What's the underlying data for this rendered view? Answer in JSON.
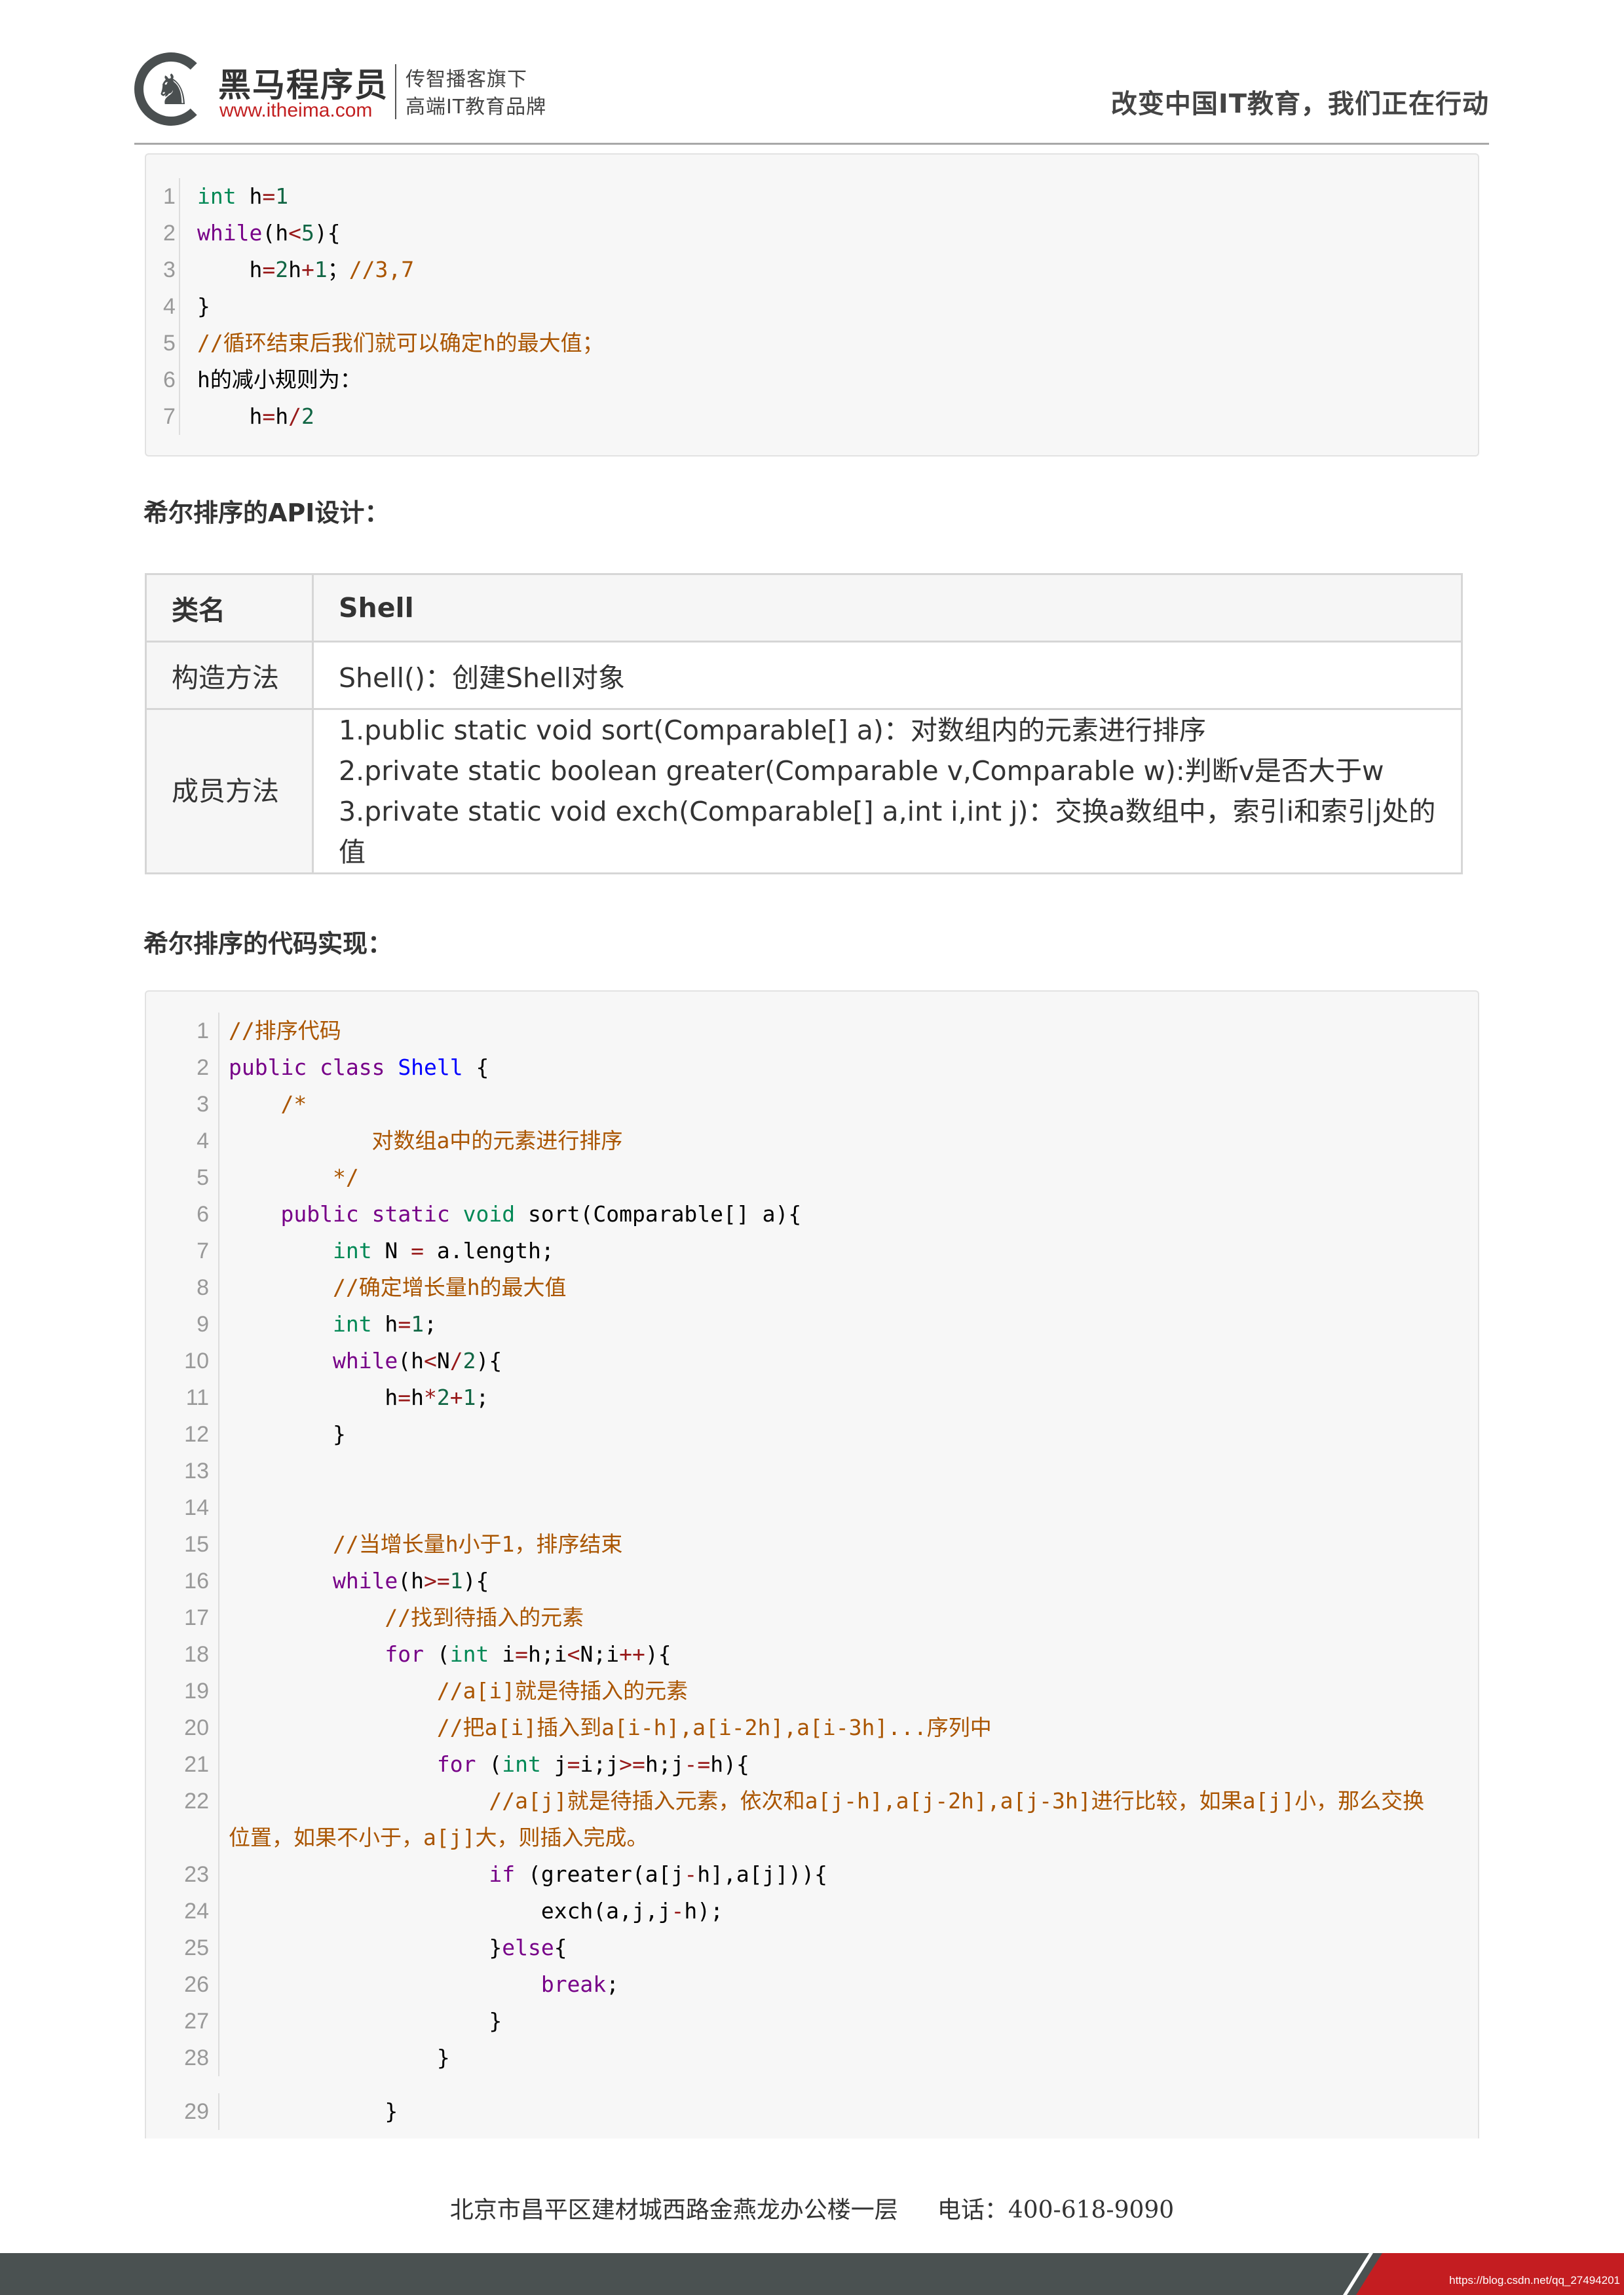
{
  "header": {
    "brand": "黑马程序员",
    "url": "www.itheima.com",
    "tagline1": "传智播客旗下",
    "tagline2": "高端IT教育品牌",
    "slogan": "改变中国IT教育，我们正在行动"
  },
  "code1": {
    "lines": [
      [
        {
          "t": "int",
          "c": "ty"
        },
        {
          "t": " h"
        },
        {
          "t": "=",
          "c": "op"
        },
        {
          "t": "1",
          "c": "nm"
        }
      ],
      [
        {
          "t": "while",
          "c": "kw"
        },
        {
          "t": "(h"
        },
        {
          "t": "<",
          "c": "op"
        },
        {
          "t": "5",
          "c": "nm"
        },
        {
          "t": "){"
        }
      ],
      [
        {
          "t": "    h"
        },
        {
          "t": "=",
          "c": "op"
        },
        {
          "t": "2",
          "c": "nm"
        },
        {
          "t": "h"
        },
        {
          "t": "+",
          "c": "op"
        },
        {
          "t": "1",
          "c": "nm"
        },
        {
          "t": "；"
        },
        {
          "t": "//3,7",
          "c": "cm"
        }
      ],
      [
        {
          "t": "}"
        }
      ],
      [
        {
          "t": "//循环结束后我们就可以确定h的最大值；",
          "c": "cm"
        }
      ],
      [
        {
          "t": "h的减小规则为："
        }
      ],
      [
        {
          "t": "    h"
        },
        {
          "t": "=",
          "c": "op"
        },
        {
          "t": "h"
        },
        {
          "t": "/",
          "c": "op"
        },
        {
          "t": "2",
          "c": "nm"
        }
      ]
    ]
  },
  "section1": {
    "title": "希尔排序的API设计："
  },
  "api_table": {
    "header": {
      "key": "类名",
      "value": "Shell"
    },
    "constructor": {
      "key": "构造方法",
      "value": "Shell()：创建Shell对象"
    },
    "members": {
      "key": "成员方法",
      "values": [
        "1.public static void sort(Comparable[] a)：对数组内的元素进行排序",
        "2.private static boolean greater(Comparable v,Comparable w):判断v是否大于w",
        "3.private static void exch(Comparable[] a,int i,int j)：交换a数组中，索引i和索引j处的值"
      ]
    }
  },
  "section2": {
    "title": "希尔排序的代码实现："
  },
  "code2": {
    "lines": [
      [
        {
          "t": "//排序代码",
          "c": "cm"
        }
      ],
      [
        {
          "t": "public",
          "c": "kw"
        },
        {
          "t": " "
        },
        {
          "t": "class",
          "c": "kw"
        },
        {
          "t": " "
        },
        {
          "t": "Shell",
          "c": "df"
        },
        {
          "t": " {"
        }
      ],
      [
        {
          "t": "    "
        },
        {
          "t": "/*",
          "c": "cm"
        }
      ],
      [
        {
          "t": "           对数组a中的元素进行排序",
          "c": "cm"
        }
      ],
      [
        {
          "t": "        "
        },
        {
          "t": "*/",
          "c": "cm"
        }
      ],
      [
        {
          "t": "    "
        },
        {
          "t": "public",
          "c": "kw"
        },
        {
          "t": " "
        },
        {
          "t": "static",
          "c": "kw"
        },
        {
          "t": " "
        },
        {
          "t": "void",
          "c": "ty"
        },
        {
          "t": " sort(Comparable[] a){"
        }
      ],
      [
        {
          "t": "        "
        },
        {
          "t": "int",
          "c": "ty"
        },
        {
          "t": " N "
        },
        {
          "t": "=",
          "c": "op"
        },
        {
          "t": " a.length;"
        }
      ],
      [
        {
          "t": "        "
        },
        {
          "t": "//确定增长量h的最大值",
          "c": "cm"
        }
      ],
      [
        {
          "t": "        "
        },
        {
          "t": "int",
          "c": "ty"
        },
        {
          "t": " h"
        },
        {
          "t": "=",
          "c": "op"
        },
        {
          "t": "1",
          "c": "nm"
        },
        {
          "t": ";"
        }
      ],
      [
        {
          "t": "        "
        },
        {
          "t": "while",
          "c": "kw"
        },
        {
          "t": "(h"
        },
        {
          "t": "<",
          "c": "op"
        },
        {
          "t": "N"
        },
        {
          "t": "/",
          "c": "op"
        },
        {
          "t": "2",
          "c": "nm"
        },
        {
          "t": "){"
        }
      ],
      [
        {
          "t": "            h"
        },
        {
          "t": "=",
          "c": "op"
        },
        {
          "t": "h"
        },
        {
          "t": "*",
          "c": "op"
        },
        {
          "t": "2",
          "c": "nm"
        },
        {
          "t": "+",
          "c": "op"
        },
        {
          "t": "1",
          "c": "nm"
        },
        {
          "t": ";"
        }
      ],
      [
        {
          "t": "        }"
        }
      ],
      [
        {
          "t": ""
        }
      ],
      [
        {
          "t": ""
        }
      ],
      [
        {
          "t": "        "
        },
        {
          "t": "//当增长量h小于1，排序结束",
          "c": "cm"
        }
      ],
      [
        {
          "t": "        "
        },
        {
          "t": "while",
          "c": "kw"
        },
        {
          "t": "(h"
        },
        {
          "t": ">=",
          "c": "op"
        },
        {
          "t": "1",
          "c": "nm"
        },
        {
          "t": "){"
        }
      ],
      [
        {
          "t": "            "
        },
        {
          "t": "//找到待插入的元素",
          "c": "cm"
        }
      ],
      [
        {
          "t": "            "
        },
        {
          "t": "for",
          "c": "kw"
        },
        {
          "t": " ("
        },
        {
          "t": "int",
          "c": "ty"
        },
        {
          "t": " i"
        },
        {
          "t": "=",
          "c": "op"
        },
        {
          "t": "h;i"
        },
        {
          "t": "<",
          "c": "op"
        },
        {
          "t": "N;i"
        },
        {
          "t": "++",
          "c": "op"
        },
        {
          "t": "){"
        }
      ],
      [
        {
          "t": "                "
        },
        {
          "t": "//a[i]就是待插入的元素",
          "c": "cm"
        }
      ],
      [
        {
          "t": "                "
        },
        {
          "t": "//把a[i]插入到a[i-h],a[i-2h],a[i-3h]...序列中",
          "c": "cm"
        }
      ],
      [
        {
          "t": "                "
        },
        {
          "t": "for",
          "c": "kw"
        },
        {
          "t": " ("
        },
        {
          "t": "int",
          "c": "ty"
        },
        {
          "t": " j"
        },
        {
          "t": "=",
          "c": "op"
        },
        {
          "t": "i;j"
        },
        {
          "t": ">=",
          "c": "op"
        },
        {
          "t": "h;j"
        },
        {
          "t": "-=",
          "c": "op"
        },
        {
          "t": "h){"
        }
      ],
      [
        {
          "t": "                    "
        },
        {
          "t": "//a[j]就是待插入元素，依次和a[j-h],a[j-2h],a[j-3h]进行比较，如果a[j]小，那么交换位置，如果不小于，a[j]大，则插入完成。",
          "c": "cm"
        }
      ],
      [
        {
          "t": "                    "
        },
        {
          "t": "if",
          "c": "kw"
        },
        {
          "t": " (greater(a[j"
        },
        {
          "t": "-",
          "c": "op"
        },
        {
          "t": "h],a[j])){"
        }
      ],
      [
        {
          "t": "                        exch(a,j,j"
        },
        {
          "t": "-",
          "c": "op"
        },
        {
          "t": "h);"
        }
      ],
      [
        {
          "t": "                    }"
        },
        {
          "t": "else",
          "c": "kw"
        },
        {
          "t": "{"
        }
      ],
      [
        {
          "t": "                        "
        },
        {
          "t": "break",
          "c": "kw"
        },
        {
          "t": ";"
        }
      ],
      [
        {
          "t": "                    }"
        }
      ],
      [
        {
          "t": "                }"
        }
      ],
      [
        {
          "t": "            }"
        }
      ]
    ]
  },
  "footer": {
    "address": "北京市昌平区建材城西路金燕龙办公楼一层",
    "phone": "电话：400-618-9090",
    "watermark_url": "https://blog.csdn.net/qq_27494201"
  },
  "colors": {
    "keyword": "#770088",
    "type": "#008855",
    "number": "#116644",
    "operator": "#981a1a",
    "comment": "#aa5500",
    "classname": "#0000ff",
    "bar": "#4a5151",
    "accent": "#c41d21"
  }
}
